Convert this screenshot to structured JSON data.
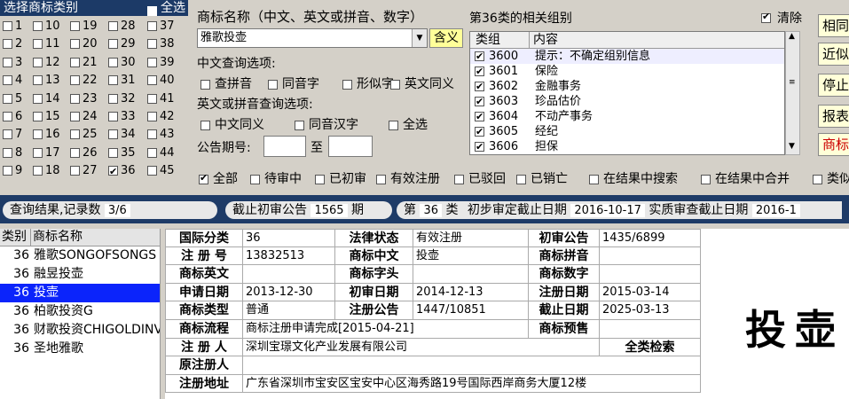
{
  "class_selector": {
    "title": "选择商标类别",
    "select_all_label": "全选",
    "columns": [
      [
        "1",
        "2",
        "3",
        "4",
        "5",
        "6",
        "7",
        "8",
        "9"
      ],
      [
        "10",
        "11",
        "12",
        "13",
        "14",
        "15",
        "16",
        "17",
        "18"
      ],
      [
        "19",
        "20",
        "21",
        "22",
        "23",
        "24",
        "25",
        "26",
        "27"
      ],
      [
        "28",
        "29",
        "30",
        "31",
        "32",
        "33",
        "34",
        "35",
        "36"
      ],
      [
        "37",
        "38",
        "39",
        "40",
        "41",
        "42",
        "43",
        "44",
        "45"
      ]
    ],
    "checked": [
      "36"
    ]
  },
  "search": {
    "name_label": "商标名称（中文、英文或拼音、数字）",
    "name_value": "雅歌投壶",
    "meaning_button": "含义",
    "cn_options_label": "中文查询选项:",
    "cn_options": [
      "查拼音",
      "同音字",
      "形似字",
      "英文同义"
    ],
    "en_options_label": "英文或拼音查询选项:",
    "en_options": [
      "中文同义",
      "同音汉字",
      "全选"
    ],
    "gazette_label": "公告期号:",
    "gazette_to": "至"
  },
  "groups": {
    "title": "第36类的相关组别",
    "clear_label": "清除",
    "col_group": "类组",
    "col_content": "内容",
    "rows": [
      {
        "code": "3600",
        "desc": "提示：不确定组别信息"
      },
      {
        "code": "3601",
        "desc": "保险"
      },
      {
        "code": "3602",
        "desc": "金融事务"
      },
      {
        "code": "3603",
        "desc": "珍品估价"
      },
      {
        "code": "3604",
        "desc": "不动产事务"
      },
      {
        "code": "3605",
        "desc": "经纪"
      },
      {
        "code": "3606",
        "desc": "担保"
      }
    ]
  },
  "side_buttons": [
    {
      "label": "相同",
      "color": "#000000"
    },
    {
      "label": "近似",
      "color": "#000000"
    },
    {
      "label": "停止",
      "color": "#000000"
    },
    {
      "label": "报表",
      "color": "#000000"
    },
    {
      "label": "商标",
      "color": "#cc0000"
    }
  ],
  "filters": [
    {
      "label": "全部",
      "checked": true
    },
    {
      "label": "待审中",
      "checked": false
    },
    {
      "label": "已初审",
      "checked": false
    },
    {
      "label": "有效注册",
      "checked": false
    },
    {
      "label": "已驳回",
      "checked": false
    },
    {
      "label": "已销亡",
      "checked": false
    },
    {
      "label": "在结果中搜索",
      "checked": false
    },
    {
      "label": "在结果中合并",
      "checked": false
    },
    {
      "label": "类似",
      "checked": false
    }
  ],
  "status": {
    "result_label": "查询结果,记录数",
    "result_count": "3/6",
    "cutoff_label": "截止初审公告",
    "cutoff_value": "1565",
    "cutoff_unit": "期",
    "class_prefix": "第",
    "class_value": "36",
    "class_suffix": "类",
    "prelim_label": "初步审定截止日期",
    "prelim_value": "2016-10-17",
    "substantive_label": "实质审查截止日期",
    "substantive_value": "2016-1"
  },
  "results": {
    "col_class": "类别",
    "col_name": "商标名称",
    "rows": [
      {
        "class": "36",
        "name": "雅歌SONGOFSONGS"
      },
      {
        "class": "36",
        "name": "融昱投壶"
      },
      {
        "class": "36",
        "name": "投壶",
        "selected": true
      },
      {
        "class": "36",
        "name": "柏歌投资G"
      },
      {
        "class": "36",
        "name": "财歌投资CHIGOLDINV"
      },
      {
        "class": "36",
        "name": "圣地雅歌"
      }
    ]
  },
  "detail": {
    "intl_class_label": "国际分类",
    "intl_class": "36",
    "legal_status_label": "法律状态",
    "legal_status": "有效注册",
    "prelim_pub_label": "初审公告",
    "prelim_pub": "1435/6899",
    "reg_no_label": "注 册 号",
    "reg_no": "13832513",
    "name_cn_label": "商标中文",
    "name_cn": "投壶",
    "pinyin_label": "商标拼音",
    "pinyin": "",
    "name_en_label": "商标英文",
    "name_en": "",
    "initial_label": "商标字头",
    "initial": "",
    "digits_label": "商标数字",
    "digits": "",
    "apply_date_label": "申请日期",
    "apply_date": "2013-12-30",
    "prelim_date_label": "初审日期",
    "prelim_date": "2014-12-13",
    "reg_date_label": "注册日期",
    "reg_date": "2015-03-14",
    "type_label": "商标类型",
    "type": "普通",
    "reg_pub_label": "注册公告",
    "reg_pub": "1447/10851",
    "expiry_label": "截止日期",
    "expiry": "2025-03-13",
    "flow_label": "商标流程",
    "flow": "商标注册申请完成[2015-04-21]",
    "alert_label": "商标预售",
    "alert": "",
    "registrant_label": "注 册 人",
    "registrant": "深圳宝璟文化产业发展有限公司",
    "all_class_search": "全类检索",
    "orig_registrant_label": "原注册人",
    "orig_registrant": "",
    "address_label": "注册地址",
    "address": "广东省深圳市宝安区宝安中心区海秀路19号国际西岸商务大厦12楼"
  },
  "preview": {
    "text": "投壶"
  }
}
